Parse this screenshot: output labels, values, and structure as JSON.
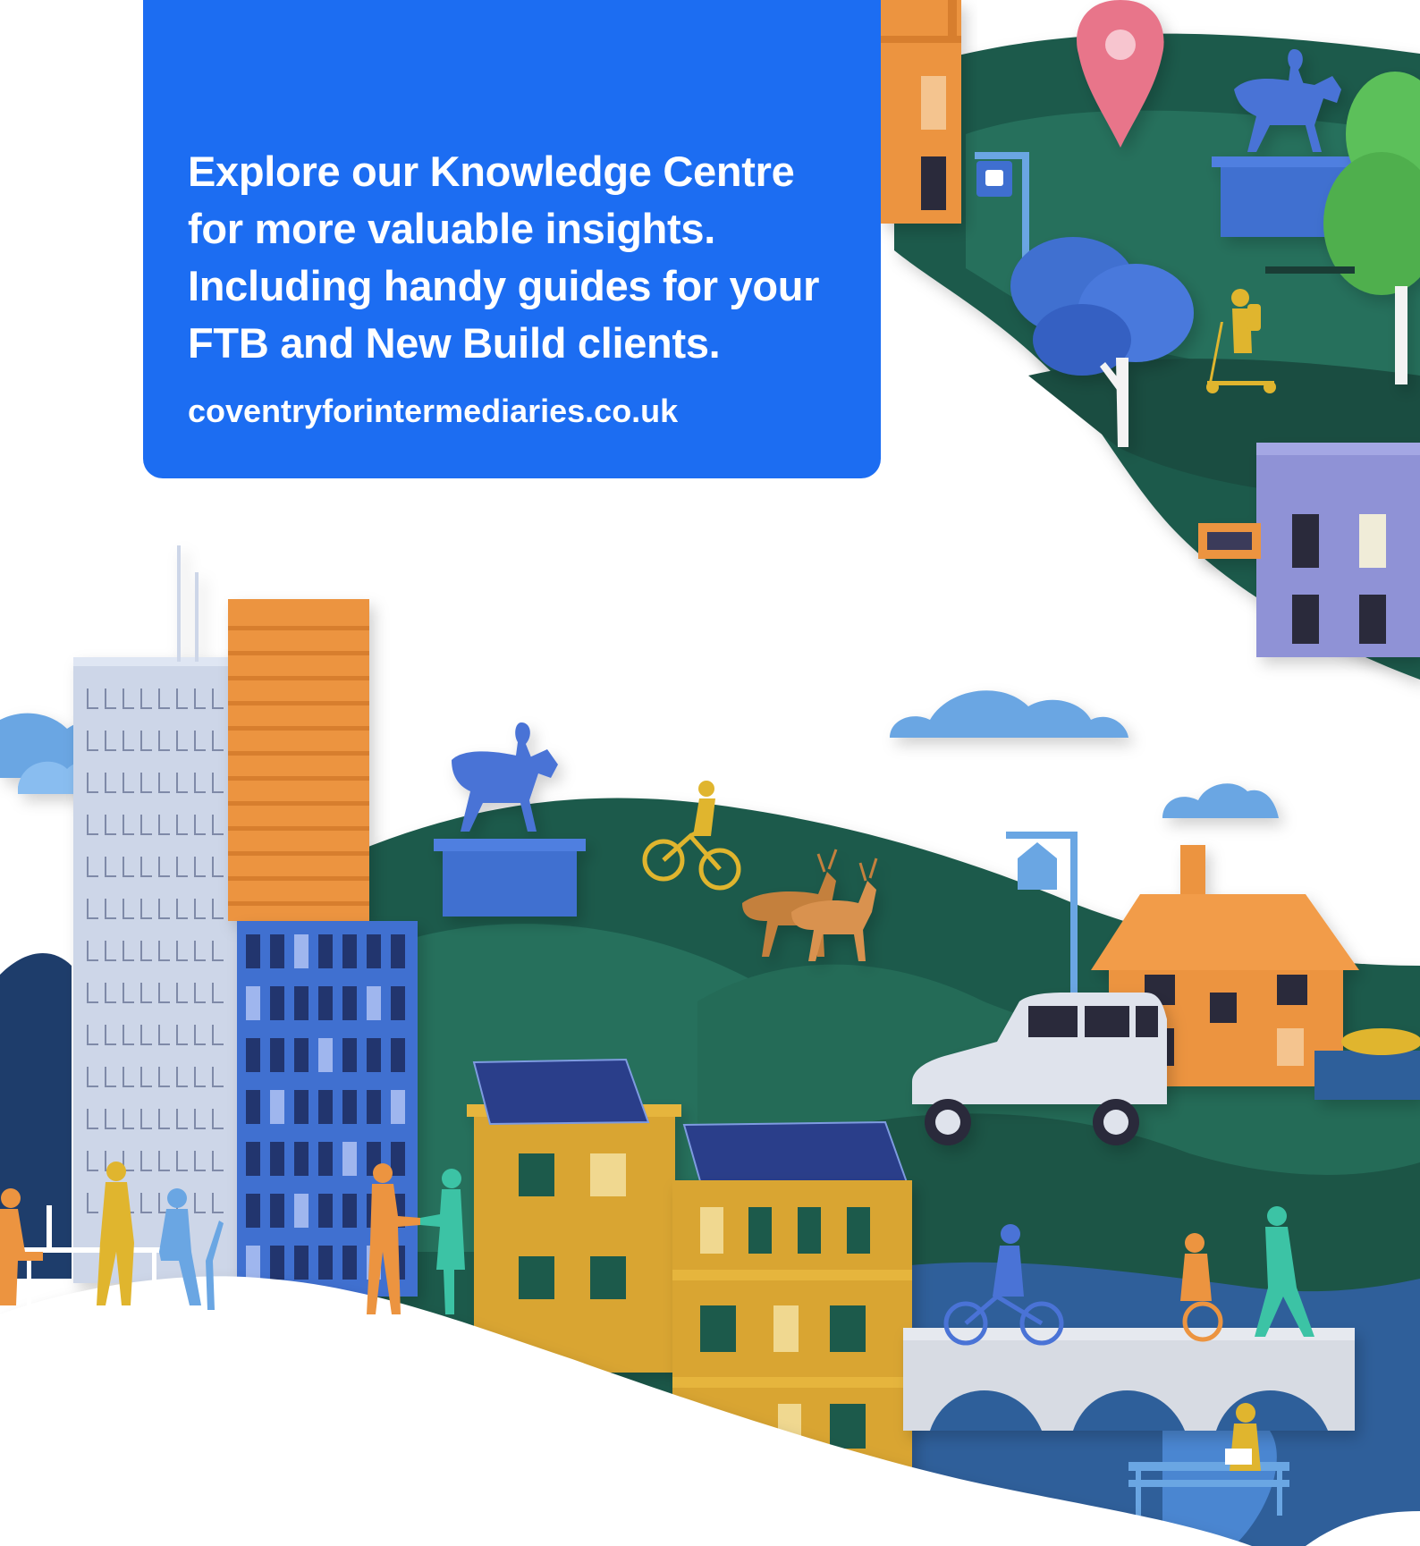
{
  "promo": {
    "heading_lines": [
      "Explore our Knowledge Centre",
      "for more valuable insights.",
      "Including handy guides for your",
      "FTB and New Build clients."
    ],
    "link_text": "coventryforintermediaries.co.uk"
  },
  "illustration": {
    "theme": "papercraft town landscape",
    "colors": {
      "card": "#1c6df2",
      "hill_dark": "#1f5a4c",
      "hill_mid": "#26705c",
      "water": "#2f5f9a",
      "orange": "#ec9440",
      "mustard": "#d9a531",
      "blue": "#3f6fd0",
      "light_blue": "#6aa6e3",
      "lavender": "#8f92d6",
      "pin": "#e8758a",
      "white": "#ffffff"
    },
    "icons": [
      "location-pin-icon",
      "horse-statue-icon",
      "bus-stop-icon",
      "tree-icon",
      "scooter-person-icon",
      "cyclist-icon",
      "deer-icon",
      "house-sign-icon",
      "solar-panel-icon",
      "car-icon",
      "bridge-icon",
      "bench-icon",
      "cloud-icon"
    ]
  }
}
